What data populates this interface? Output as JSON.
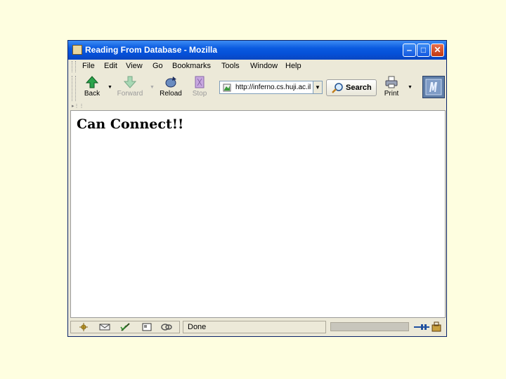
{
  "window": {
    "title": "Reading From Database - Mozilla",
    "controls": {
      "minimize": "‒",
      "maximize": "□",
      "close": "✕"
    }
  },
  "menu": [
    "File",
    "Edit",
    "View",
    "Go",
    "Bookmarks",
    "Tools",
    "Window",
    "Help"
  ],
  "toolbar": {
    "back_label": "Back",
    "forward_label": "Forward",
    "reload_label": "Reload",
    "stop_label": "Stop",
    "print_label": "Print",
    "search_label": "Search",
    "url": "http://inferno.cs.huji.ac.il",
    "dropdown_glyph": "▼"
  },
  "page": {
    "heading": "Can Connect!!"
  },
  "status": {
    "text": "Done"
  },
  "colors": {
    "background": "#fefee0",
    "titlebar": "#0a5ae0",
    "chrome": "#ece9d8"
  }
}
